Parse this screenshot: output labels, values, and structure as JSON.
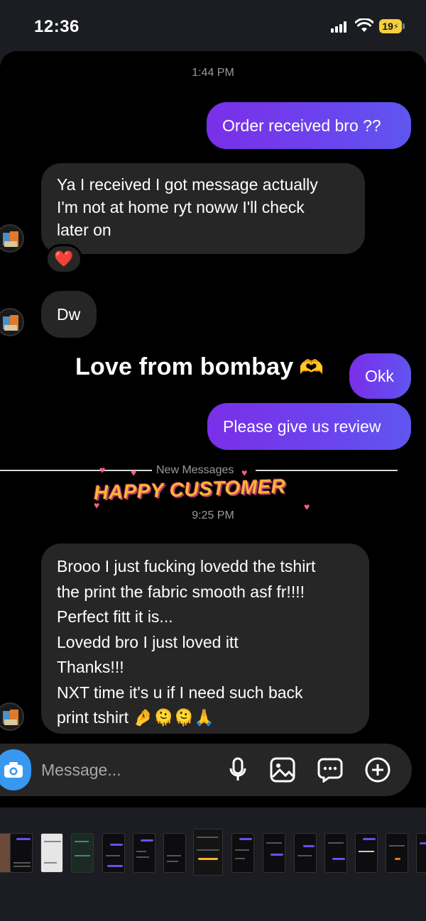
{
  "status_bar": {
    "time": "12:36",
    "battery": "19"
  },
  "chat": {
    "time_1": "1:44 PM",
    "msg_out_1": "Order received bro ??",
    "msg_in_1_lines": [
      "Ya I received I got message actually",
      "I'm not at home ryt noww I'll check",
      "later on"
    ],
    "reaction_1": "❤️",
    "msg_in_2": "Dw",
    "sticker_love": "Love from bombay",
    "sticker_love_emoji": "🫶",
    "msg_out_2": "Okk",
    "msg_out_3": "Please give us review",
    "new_messages": "New Messages",
    "sticker_happy": "HAPPY CUSTOMER",
    "time_2": "9:25 PM",
    "msg_in_3_lines": [
      "Brooo I just fucking lovedd the tshirt",
      "the print the fabric smooth asf fr!!!!",
      "Perfect fitt it is...",
      "Lovedd bro I just loved itt",
      "Thanks!!!",
      "NXT time it's u if I need such back",
      "print tshirt 🤌🫠🫠🙏"
    ]
  },
  "composer": {
    "placeholder": "Message..."
  },
  "icons": {
    "camera": "camera-icon",
    "mic": "microphone-icon",
    "gallery": "image-icon",
    "sticker": "chat-bubble-icon",
    "add": "plus-circle-icon"
  },
  "colors": {
    "outgoing_bubble": "#7a2fe8",
    "incoming_bubble": "#262626",
    "accent_blue": "#3897f0"
  }
}
